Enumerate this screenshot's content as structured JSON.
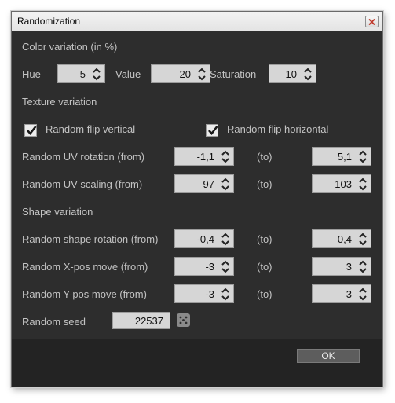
{
  "window": {
    "title": "Randomization"
  },
  "color_variation": {
    "heading": "Color variation (in %)",
    "hue": {
      "label": "Hue",
      "value": "5"
    },
    "value": {
      "label": "Value",
      "value": "20"
    },
    "saturation": {
      "label": "Saturation",
      "value": "10"
    }
  },
  "texture_variation": {
    "heading": "Texture variation",
    "flip_vertical": {
      "label": "Random flip vertical",
      "checked": true
    },
    "flip_horizontal": {
      "label": "Random flip horizontal",
      "checked": true
    },
    "uv_rotation": {
      "label": "Random UV rotation (from)",
      "from": "-1,1",
      "to_label": "(to)",
      "to": "5,1"
    },
    "uv_scaling": {
      "label": "Random UV scaling (from)",
      "from": "97",
      "to_label": "(to)",
      "to": "103"
    }
  },
  "shape_variation": {
    "heading": "Shape variation",
    "rotation": {
      "label": "Random shape rotation (from)",
      "from": "-0,4",
      "to_label": "(to)",
      "to": "0,4"
    },
    "xpos": {
      "label": "Random X-pos move (from)",
      "from": "-3",
      "to_label": "(to)",
      "to": "3"
    },
    "ypos": {
      "label": "Random Y-pos move (from)",
      "from": "-3",
      "to_label": "(to)",
      "to": "3"
    }
  },
  "seed": {
    "label": "Random seed",
    "value": "22537",
    "icon": "dice-icon"
  },
  "footer": {
    "ok_label": "OK"
  },
  "colors": {
    "background": "#2d2d2d",
    "label_text": "#c3c3c3",
    "field_bg": "#d6d6d6",
    "button_bg": "#5d5d5d"
  }
}
